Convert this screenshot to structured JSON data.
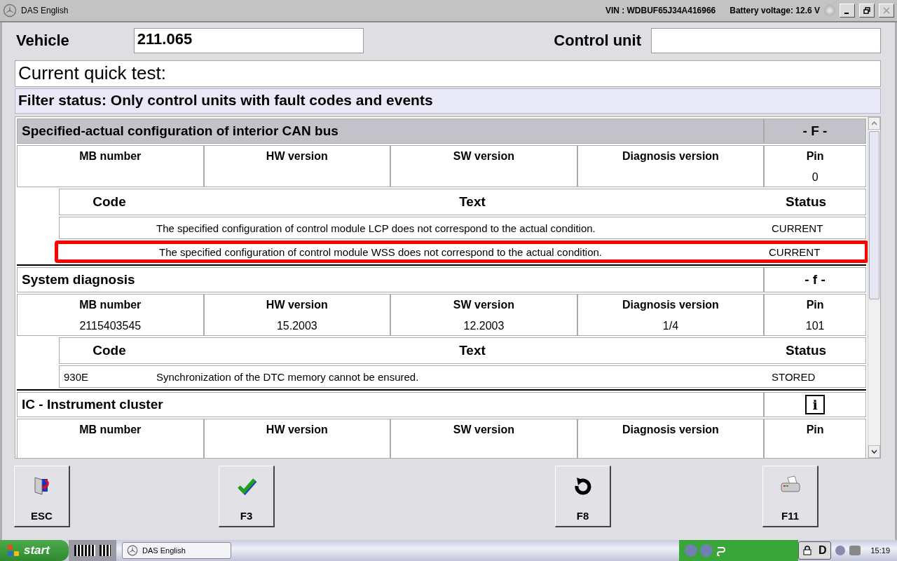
{
  "window": {
    "title": "DAS English",
    "vin": "VIN : WDBUF65J34A416966",
    "battery": "Battery voltage: 12.6 V"
  },
  "vehicle": {
    "label": "Vehicle",
    "value": "211.065"
  },
  "control_unit": {
    "label": "Control unit"
  },
  "quick_test": "Current quick test:",
  "filter_status": "Filter status: Only control units with fault codes and events",
  "sections": [
    {
      "title": "Specified-actual configuration of interior CAN bus",
      "kind": "text",
      "flag": "- F -",
      "selected": true,
      "info": [
        {
          "column": "MB number"
        },
        {
          "column": "HW version"
        },
        {
          "column": "SW version"
        },
        {
          "column": "Diagnosis version"
        },
        {
          "column": "Pin",
          "value": "0"
        }
      ],
      "fault_columns": [
        "Code",
        "Text",
        "Status"
      ],
      "faults": [
        {
          "text": "The specified configuration of control module LCP does not correspond to the actual condition.",
          "status": "CURRENT",
          "highlighted": false
        },
        {
          "text": "The specified configuration of control module WSS does not correspond to the actual condition.",
          "status": "CURRENT",
          "highlighted": true
        }
      ]
    },
    {
      "title": "System diagnosis",
      "kind": "text",
      "flag": "- f -",
      "selected": false,
      "info": [
        {
          "column": "MB number",
          "value": "2115403545"
        },
        {
          "column": "HW version",
          "value": "15.2003"
        },
        {
          "column": "SW version",
          "value": "12.2003"
        },
        {
          "column": "Diagnosis version",
          "value": "1/4"
        },
        {
          "column": "Pin",
          "value": "101"
        }
      ],
      "fault_columns": [
        "Code",
        "Text",
        "Status"
      ],
      "faults": [
        {
          "code": "930E",
          "text": "Synchronization of the DTC memory cannot be ensured.",
          "status": "STORED",
          "highlighted": false
        }
      ]
    },
    {
      "title": "IC - Instrument cluster",
      "kind": "info",
      "flag": "i",
      "selected": false,
      "info": [
        {
          "column": "MB number"
        },
        {
          "column": "HW version"
        },
        {
          "column": "SW version"
        },
        {
          "column": "Diagnosis version"
        },
        {
          "column": "Pin"
        }
      ]
    }
  ],
  "buttons": [
    {
      "label": "ESC",
      "kind": "exit"
    },
    {
      "label": "F3",
      "kind": "check"
    },
    {
      "label": "F8",
      "kind": "undo"
    },
    {
      "label": "F11",
      "kind": "print"
    }
  ],
  "taskbar": {
    "start": "start",
    "task": "DAS English",
    "tray_letter": "D",
    "clock": "15:19"
  }
}
